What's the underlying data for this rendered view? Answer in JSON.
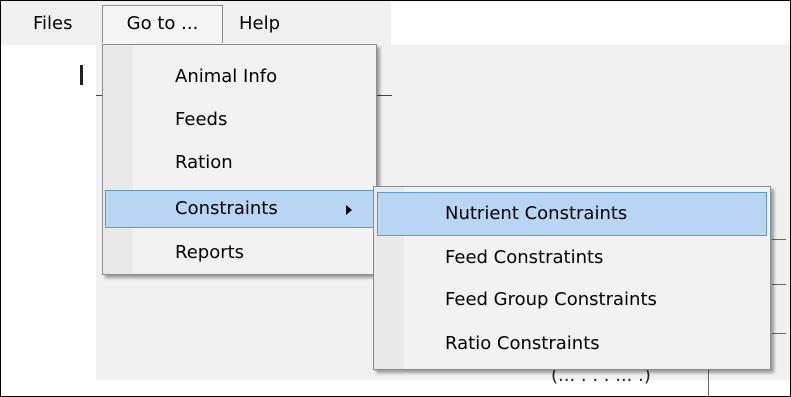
{
  "menubar": {
    "files_label": "Files",
    "goto_label": "Go to ...",
    "help_label": "Help"
  },
  "goto_menu": {
    "items": [
      {
        "label": "Animal Info"
      },
      {
        "label": "Feeds"
      },
      {
        "label": "Ration"
      },
      {
        "label": "Constraints",
        "has_submenu": true,
        "highlighted": true
      },
      {
        "label": "Reports"
      }
    ]
  },
  "constraints_submenu": {
    "items": [
      {
        "label": "Nutrient Constraints",
        "highlighted": true
      },
      {
        "label": "Feed Constratints"
      },
      {
        "label": "Feed Group Constraints"
      },
      {
        "label": "Ratio Constraints"
      }
    ]
  },
  "colors": {
    "highlight_fill": "#b8d6f4",
    "highlight_border": "#5b9bd5",
    "menu_background": "#f2f2f2",
    "form_background": "#f0f0f0"
  },
  "background": {
    "clipped_text": "(... . . . ... .)"
  }
}
